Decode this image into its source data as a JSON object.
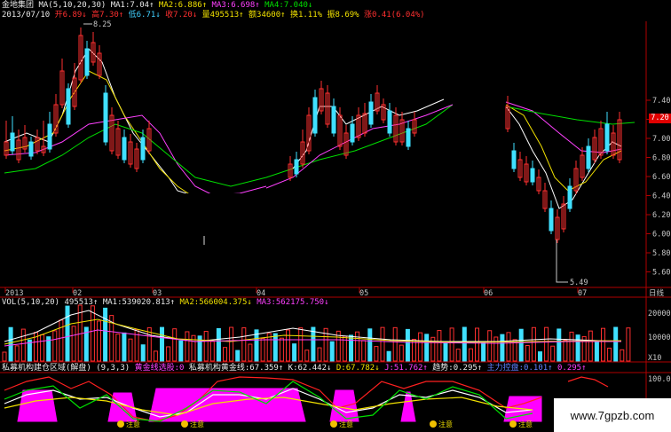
{
  "header": {
    "symbol": "金地集团",
    "ma_label": "MA(5,10,20,30)",
    "ma1": "MA1:7.04↑",
    "ma2": "MA2:6.886↑",
    "ma3": "MA3:6.698↑",
    "ma4": "MA4:7.040↓",
    "date": "2013/07/10",
    "open": "开6.89↓",
    "high": "高7.30↑",
    "low": "低6.71↓",
    "close": "收7.20↓",
    "volume": "量495513↑",
    "amount": "额34600↑",
    "turnover": "换1.11%",
    "amplitude": "振8.69%",
    "change": "涨0.41(6.04%)"
  },
  "price_axis": [
    "7.40",
    "7.20",
    "7.00",
    "6.80",
    "6.60",
    "6.40",
    "6.20",
    "6.00",
    "5.80",
    "5.60"
  ],
  "current_price": "7.20",
  "annotations": {
    "high": "8.25",
    "low": "5.49"
  },
  "time_axis": [
    "2013",
    "02",
    "03",
    "04",
    "05",
    "06",
    "07"
  ],
  "time_axis_unit": "日线",
  "volume_panel": {
    "label": "VOL(5,10,20)",
    "vol": "495513↑",
    "ma1": "MA1:539020.813↑",
    "ma2": "MA2:566004.375↓",
    "ma3": "MA3:562175.750↓",
    "axis": [
      "200000",
      "100000"
    ],
    "unit": "X10"
  },
  "indicator_panel": {
    "name": "私募机构建仓区域(解盘)",
    "params": "(9,3,3)",
    "gold": "黄金线选股:0",
    "gold_line": "私募机构黄金线:67.359↑",
    "k": "K:62.442↓",
    "d": "D:67.782↓",
    "j": "J:51.762↑",
    "trend": "趋势:0.295↑",
    "extra": "主力控盘:0.101↑",
    "extra2": "0.295↑",
    "axis": [
      "100.00"
    ],
    "marks": [
      "注意",
      "注意",
      "注意",
      "注意",
      "注意"
    ]
  },
  "watermark": "www.7gpzb.com",
  "colors": {
    "up": "#ff3030",
    "down": "#40e0ff",
    "ma1": "#ffffff",
    "ma2": "#f0e000",
    "ma3": "#ff40ff",
    "ma4": "#00e000",
    "fill": "#ff00ff"
  }
}
